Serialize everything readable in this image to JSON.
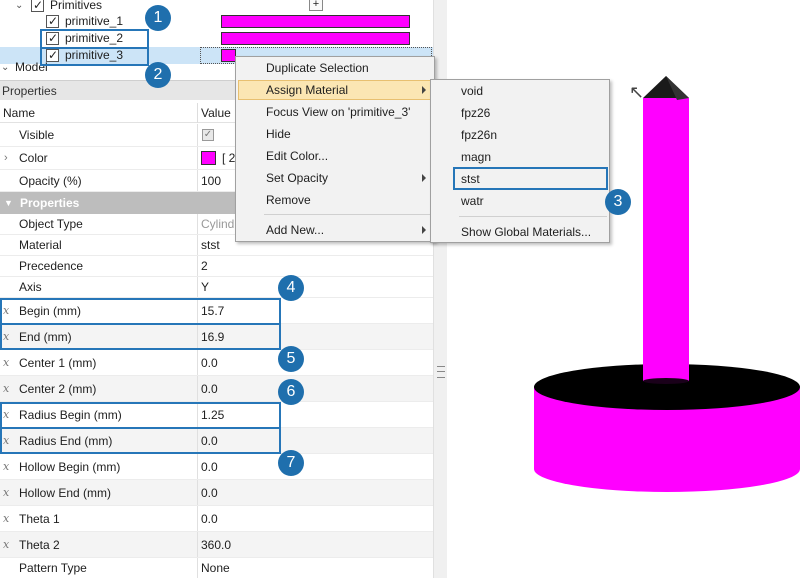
{
  "tree": {
    "group_label": "Primitives",
    "add_button": "+",
    "items": [
      {
        "label": "primitive_1"
      },
      {
        "label": "primitive_2"
      },
      {
        "label": "primitive_3"
      }
    ],
    "model_label": "Model"
  },
  "properties_panel": {
    "title": "Properties",
    "col_name": "Name",
    "col_value": "Value",
    "rows_top": [
      {
        "name": "Visible",
        "value": ""
      },
      {
        "name": "Color",
        "value": "[ 2"
      },
      {
        "name": "Opacity (%)",
        "value": "100"
      }
    ],
    "section_title": "Properties",
    "rows": [
      {
        "name": "Object Type",
        "value": "Cylind"
      },
      {
        "name": "Material",
        "value": "stst"
      },
      {
        "name": "Precedence",
        "value": "2"
      },
      {
        "name": "Axis",
        "value": "Y"
      },
      {
        "name": "Begin (mm)",
        "value": "15.7"
      },
      {
        "name": "End (mm)",
        "value": "16.9"
      },
      {
        "name": "Center 1 (mm)",
        "value": "0.0"
      },
      {
        "name": "Center 2 (mm)",
        "value": "0.0"
      },
      {
        "name": "Radius Begin (mm)",
        "value": "1.25"
      },
      {
        "name": "Radius End (mm)",
        "value": "0.0"
      },
      {
        "name": "Hollow Begin (mm)",
        "value": "0.0"
      },
      {
        "name": "Hollow End (mm)",
        "value": "0.0"
      },
      {
        "name": "Theta 1",
        "value": "0.0"
      },
      {
        "name": "Theta 2",
        "value": "360.0"
      },
      {
        "name": "Pattern Type",
        "value": "None"
      }
    ]
  },
  "context_menu": {
    "items": [
      "Duplicate Selection",
      "Assign Material",
      "Focus View on 'primitive_3'",
      "Hide",
      "Edit Color...",
      "Set Opacity",
      "Remove",
      "Add New..."
    ]
  },
  "material_submenu": {
    "items": [
      "void",
      "fpz26",
      "fpz26n",
      "magn",
      "stst",
      "watr"
    ],
    "footer": "Show Global Materials..."
  },
  "badges": [
    "1",
    "2",
    "3",
    "4",
    "5",
    "6",
    "7"
  ],
  "colors": {
    "primitive_color": "#ff00ff",
    "callout": "#2676b8",
    "badge": "#1f6fad",
    "menu_highlight": "#fbe6b3"
  }
}
